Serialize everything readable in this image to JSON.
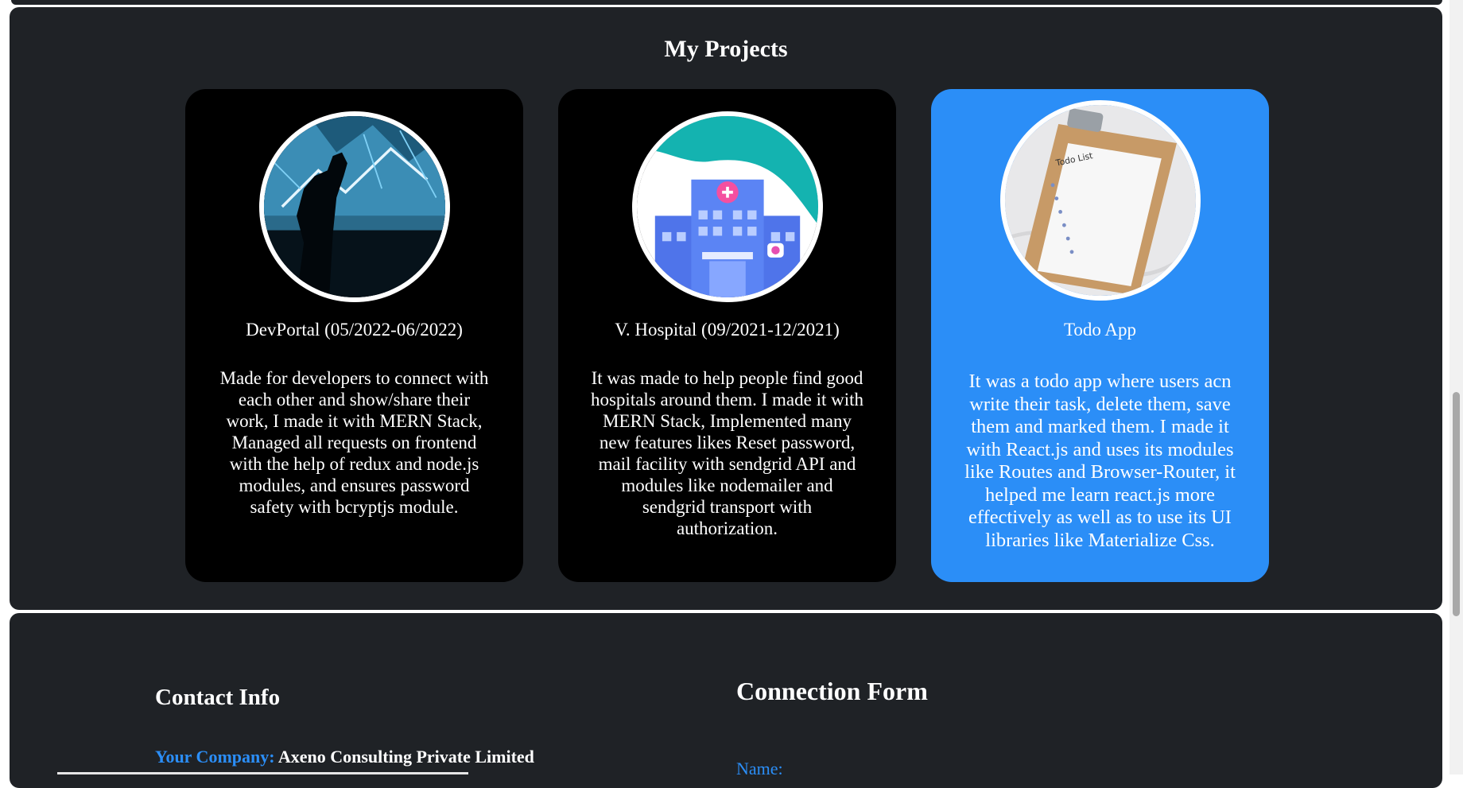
{
  "projects": {
    "title": "My Projects",
    "cards": [
      {
        "title": "DevPortal (05/2022-06/2022)",
        "description": "Made for developers to connect with each other and show/share their work, I made it with MERN Stack, Managed all requests on frontend with the help of redux and node.js modules, and ensures password safety with bcryptjs module.",
        "image": "person-silhouette-tech-image"
      },
      {
        "title": "V. Hospital (09/2021-12/2021)",
        "description": "It was made to help people find good hospitals around them. I made it with MERN Stack, Implemented many new features likes Reset password, mail facility with sendgrid API and modules like nodemailer and sendgrid transport with authorization.",
        "image": "hospital-building-illustration"
      },
      {
        "title": "Todo App",
        "description": "It was a todo app where users acn write their task, delete them, save them and marked them. I made it with React.js and uses its modules like Routes and Browser-Router, it helped me learn react.js more effectively as well as to use its UI libraries like Materialize Css.",
        "image": "clipboard-todo-list-image",
        "image_text": "Todo List"
      }
    ]
  },
  "contact": {
    "title": "Contact Info",
    "company_label": "Your Company:",
    "company_value": "Axeno Consulting Private Limited"
  },
  "form": {
    "title": "Connection Form",
    "name_label": "Name:"
  },
  "colors": {
    "panel_bg": "#1f2226",
    "card_bg": "#000000",
    "accent": "#2b8ef7",
    "text": "#ffffff"
  }
}
